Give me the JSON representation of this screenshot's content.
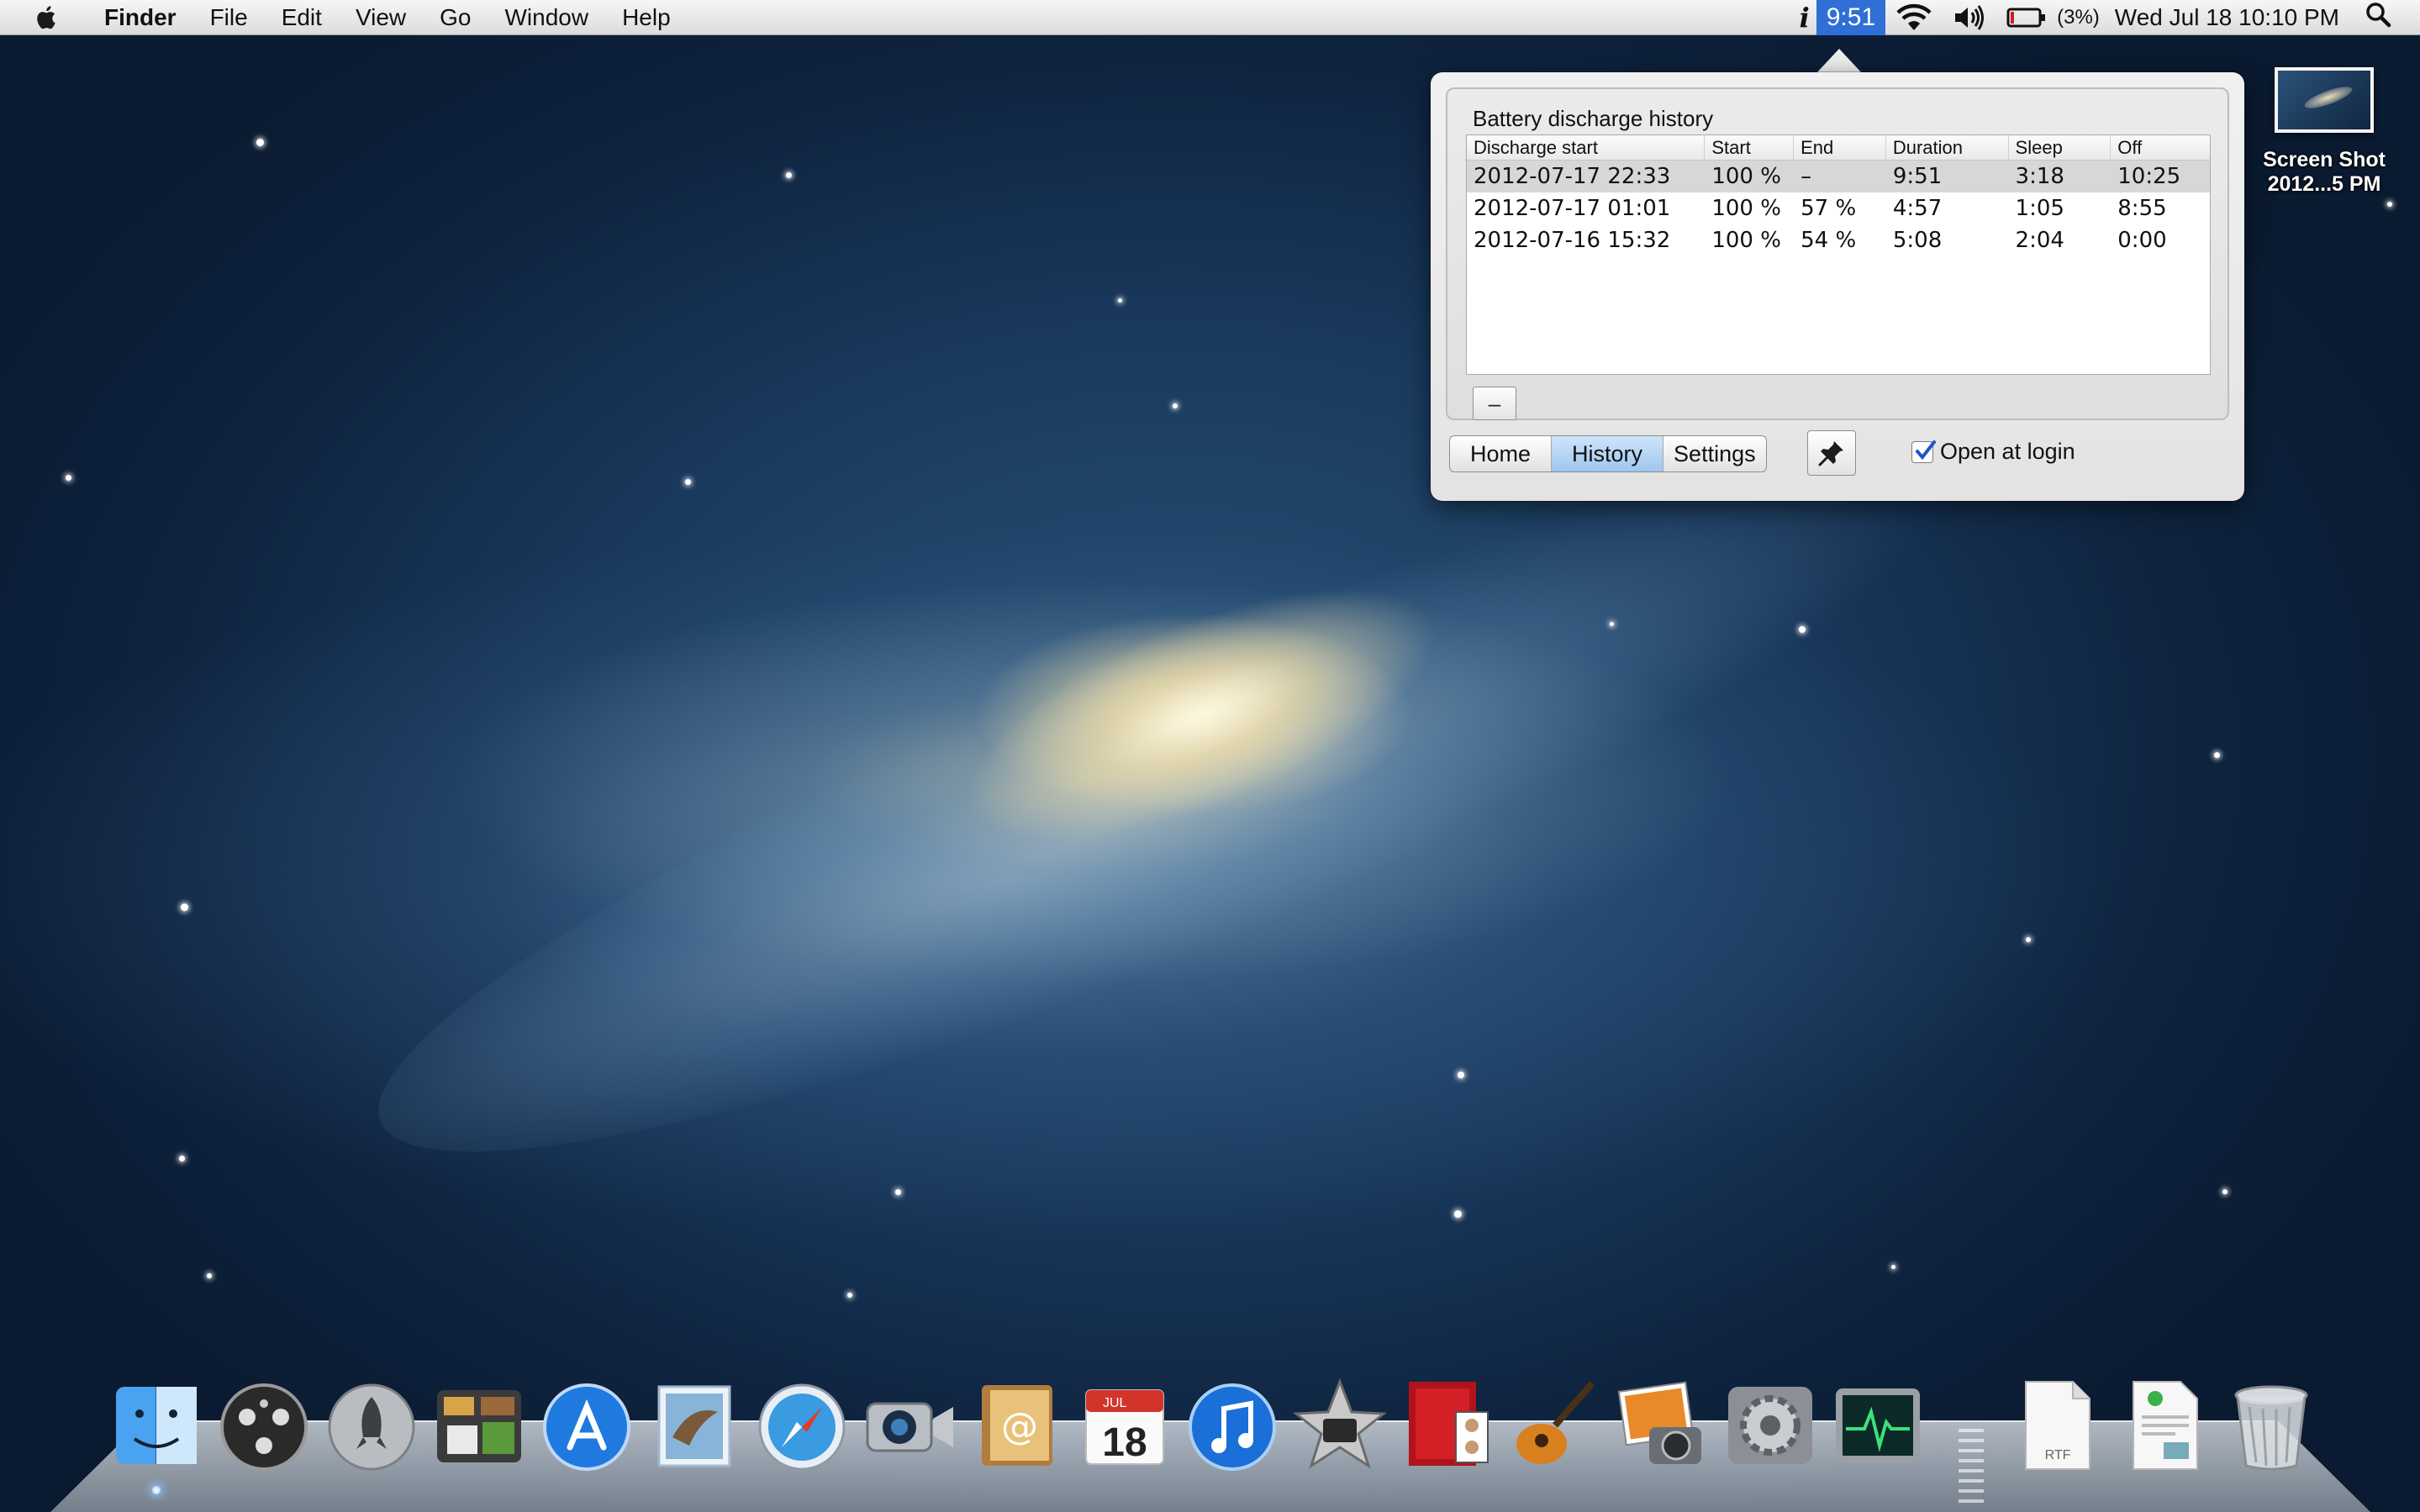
{
  "menubar": {
    "app_name": "Finder",
    "menus": [
      "File",
      "Edit",
      "View",
      "Go",
      "Window",
      "Help"
    ],
    "status": {
      "info_glyph": "i",
      "battery_time": "9:51",
      "battery_percent": "(3%)",
      "clock": "Wed Jul 18  10:10 PM"
    }
  },
  "popover": {
    "title": "Battery discharge history",
    "columns": [
      "Discharge start",
      "Start",
      "End",
      "Duration",
      "Sleep",
      "Off"
    ],
    "rows": [
      [
        "2012-07-17 22:33",
        "100 %",
        "–",
        "9:51",
        "3:18",
        "10:25"
      ],
      [
        "2012-07-17 01:01",
        "100 %",
        "57 %",
        "4:57",
        "1:05",
        "8:55"
      ],
      [
        "2012-07-16 15:32",
        "100 %",
        "54 %",
        "5:08",
        "2:04",
        "0:00"
      ]
    ],
    "selected_row": 0,
    "remove_label": "–",
    "tabs": [
      "Home",
      "History",
      "Settings"
    ],
    "active_tab": "History",
    "open_at_login_label": "Open at login",
    "open_at_login_checked": true
  },
  "desktop": {
    "file_label_line1": "Screen Shot",
    "file_label_line2": "2012...5 PM"
  },
  "dock": {
    "apps": [
      "finder-icon",
      "dashboard-icon",
      "launchpad-icon",
      "mission-control-icon",
      "app-store-icon",
      "mail-icon",
      "safari-icon",
      "facetime-icon",
      "contacts-icon",
      "calendar-icon",
      "itunes-icon",
      "imovie-icon",
      "photo-booth-icon",
      "garageband-icon",
      "iphoto-icon",
      "system-preferences-icon",
      "activity-monitor-icon",
      "rtf-document-icon",
      "document-icon",
      "trash-icon"
    ],
    "calendar_month": "JUL",
    "calendar_day": "18",
    "rtf_label": "RTF",
    "colors": {
      "accent": "#2f6fd6",
      "selection_tab": "#b7d6f6"
    }
  }
}
